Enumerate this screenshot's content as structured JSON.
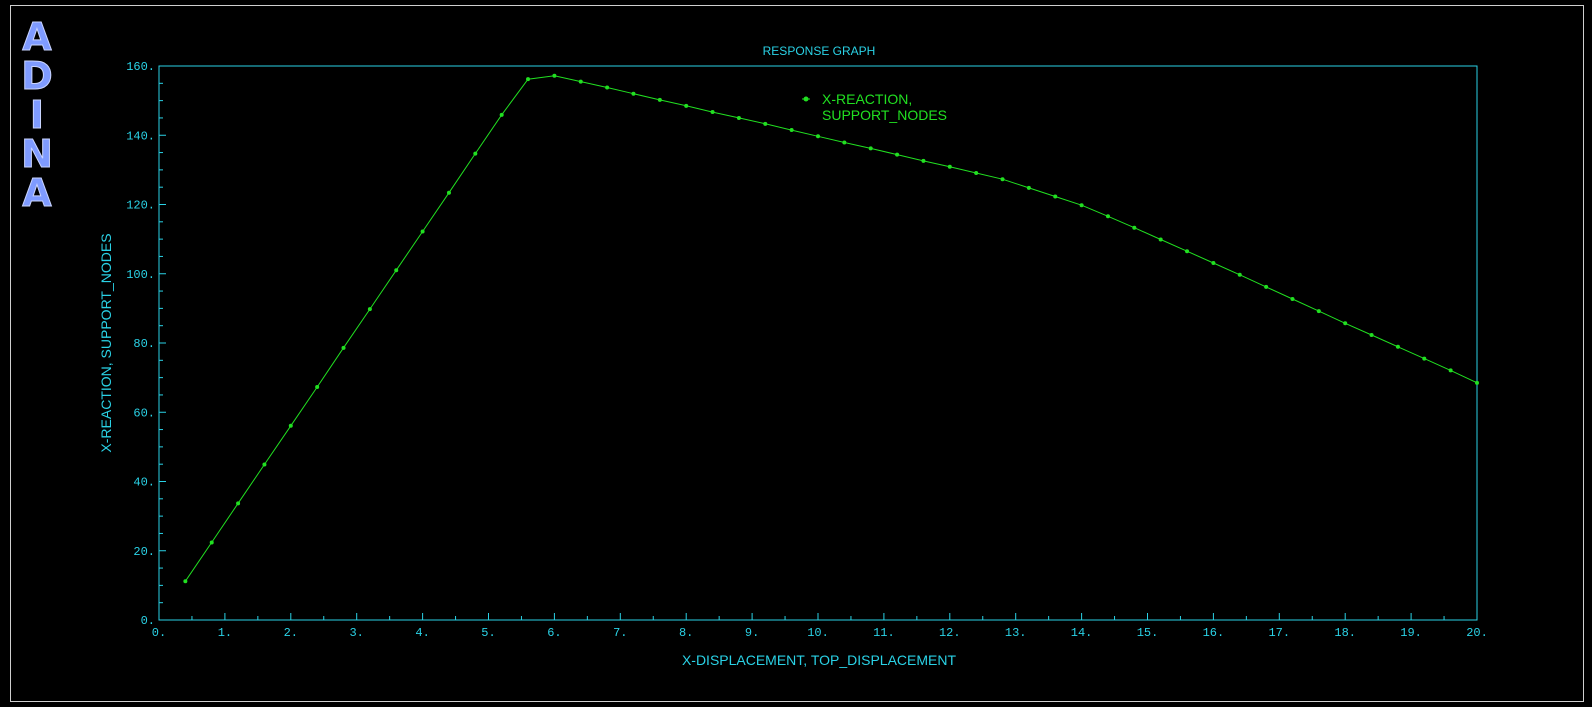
{
  "logo": {
    "letters": [
      "A",
      "D",
      "I",
      "N",
      "A"
    ]
  },
  "chart_data": {
    "type": "line",
    "title": "RESPONSE GRAPH",
    "xlabel": "X-DISPLACEMENT, TOP_DISPLACEMENT",
    "ylabel": "X-REACTION, SUPPORT_NODES",
    "xlim": [
      0,
      20
    ],
    "ylim": [
      0,
      160
    ],
    "x_ticks": [
      "0.",
      "1.",
      "2.",
      "3.",
      "4.",
      "5.",
      "6.",
      "7.",
      "8.",
      "9.",
      "10.",
      "11.",
      "12.",
      "13.",
      "14.",
      "15.",
      "16.",
      "17.",
      "18.",
      "19.",
      "20."
    ],
    "y_ticks": [
      "0.",
      "20.",
      "40.",
      "60.",
      "80.",
      "100.",
      "120.",
      "140.",
      "160."
    ],
    "grid": false,
    "legend_position": "top-center",
    "series": [
      {
        "name": "X-REACTION, SUPPORT_NODES",
        "legend_lines": [
          "X-REACTION,",
          "SUPPORT_NODES"
        ],
        "color": "#21e021",
        "x": [
          0.4,
          0.8,
          1.2,
          1.6,
          2.0,
          2.4,
          2.8,
          3.2,
          3.6,
          4.0,
          4.4,
          4.8,
          5.2,
          5.6,
          6.0,
          6.4,
          6.8,
          7.2,
          7.6,
          8.0,
          8.4,
          8.8,
          9.2,
          9.6,
          10.0,
          10.4,
          10.8,
          11.2,
          11.6,
          12.0,
          12.4,
          12.8,
          13.2,
          13.6,
          14.0,
          14.4,
          14.8,
          15.2,
          15.6,
          16.0,
          16.4,
          16.8,
          17.2,
          17.6,
          18.0,
          18.4,
          18.8,
          19.2,
          19.6,
          20.0
        ],
        "y": [
          11.2,
          22.4,
          33.7,
          44.9,
          56.1,
          67.3,
          78.6,
          89.8,
          101.0,
          112.2,
          123.4,
          134.7,
          145.9,
          156.2,
          157.2,
          155.5,
          153.8,
          152.0,
          150.2,
          148.5,
          146.7,
          145.0,
          143.3,
          141.5,
          139.7,
          137.9,
          136.2,
          134.4,
          132.6,
          130.9,
          129.1,
          127.3,
          124.8,
          122.3,
          119.8,
          116.6,
          113.3,
          109.9,
          106.5,
          103.1,
          99.7,
          96.2,
          92.7,
          89.2,
          85.7,
          82.3,
          78.9,
          75.5,
          72.1,
          68.5
        ]
      }
    ]
  }
}
